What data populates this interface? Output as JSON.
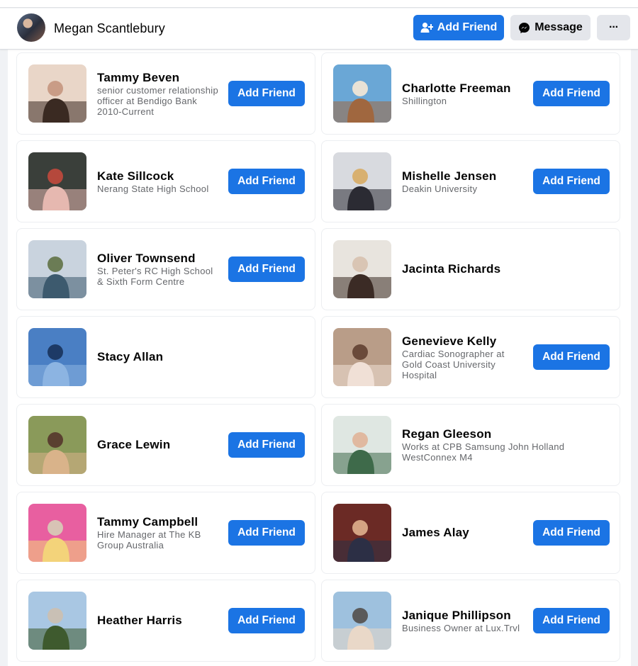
{
  "header": {
    "profile_name": "Megan Scantlebury",
    "add_friend_label": "Add Friend",
    "message_label": "Message",
    "more_label": "···"
  },
  "friends": [
    {
      "name": "Tammy Beven",
      "subtitle": "senior customer relationship officer at Bendigo Bank 2010-Current",
      "button": "Add Friend",
      "photo_colors": [
        "#e9d6c8",
        "#3a2a22",
        "#c99c86"
      ]
    },
    {
      "name": "Charlotte Freeman",
      "subtitle": "Shillington",
      "button": "Add Friend",
      "photo_colors": [
        "#6aa7d6",
        "#a0673f",
        "#e8e2d6"
      ]
    },
    {
      "name": "Kate Sillcock",
      "subtitle": "Nerang State High School",
      "button": "Add Friend",
      "photo_colors": [
        "#3a3f3a",
        "#e6b8b0",
        "#b5483c"
      ]
    },
    {
      "name": "Mishelle Jensen",
      "subtitle": "Deakin University",
      "button": "Add Friend",
      "photo_colors": [
        "#d8dadf",
        "#2b2b33",
        "#d8b070"
      ]
    },
    {
      "name": "Oliver Townsend",
      "subtitle": "St. Peter's RC High School & Sixth Form Centre",
      "button": "Add Friend",
      "photo_colors": [
        "#c9d3de",
        "#3d5a6e",
        "#6b7c55"
      ]
    },
    {
      "name": "Jacinta Richards",
      "subtitle": "",
      "button": "",
      "photo_colors": [
        "#e8e4de",
        "#3b2b25",
        "#d9c5b4"
      ]
    },
    {
      "name": "Stacy Allan",
      "subtitle": "",
      "button": "",
      "photo_colors": [
        "#4a7fc4",
        "#8cb4e2",
        "#1d3a66"
      ]
    },
    {
      "name": "Genevieve Kelly",
      "subtitle": "Cardiac Sonographer at Gold Coast University Hospital",
      "button": "Add Friend",
      "photo_colors": [
        "#b99d88",
        "#f0e0d6",
        "#6a4a3a"
      ]
    },
    {
      "name": "Grace Lewin",
      "subtitle": "",
      "button": "Add Friend",
      "photo_colors": [
        "#8a9a5a",
        "#d9b38a",
        "#5a4030"
      ]
    },
    {
      "name": "Regan Gleeson",
      "subtitle": "Works at CPB Samsung John Holland WestConnex M4",
      "button": "",
      "photo_colors": [
        "#dfe7e2",
        "#3e6a4a",
        "#e0b9a0"
      ]
    },
    {
      "name": "Tammy Campbell",
      "subtitle": "Hire Manager at The KB Group Australia",
      "button": "Add Friend",
      "photo_colors": [
        "#e85fa0",
        "#f3d37a",
        "#d8c3b5"
      ]
    },
    {
      "name": "James Alay",
      "subtitle": "",
      "button": "Add Friend",
      "photo_colors": [
        "#6b2a25",
        "#2c2f45",
        "#d4a383"
      ]
    },
    {
      "name": "Heather Harris",
      "subtitle": "",
      "button": "Add Friend",
      "photo_colors": [
        "#a9c7e3",
        "#3e5a2e",
        "#c9c0b5"
      ]
    },
    {
      "name": "Janique Phillipson",
      "subtitle": "Business Owner at Lux.Trvl",
      "button": "Add Friend",
      "photo_colors": [
        "#9ec1de",
        "#e9d8c8",
        "#5a5a5a"
      ]
    }
  ]
}
